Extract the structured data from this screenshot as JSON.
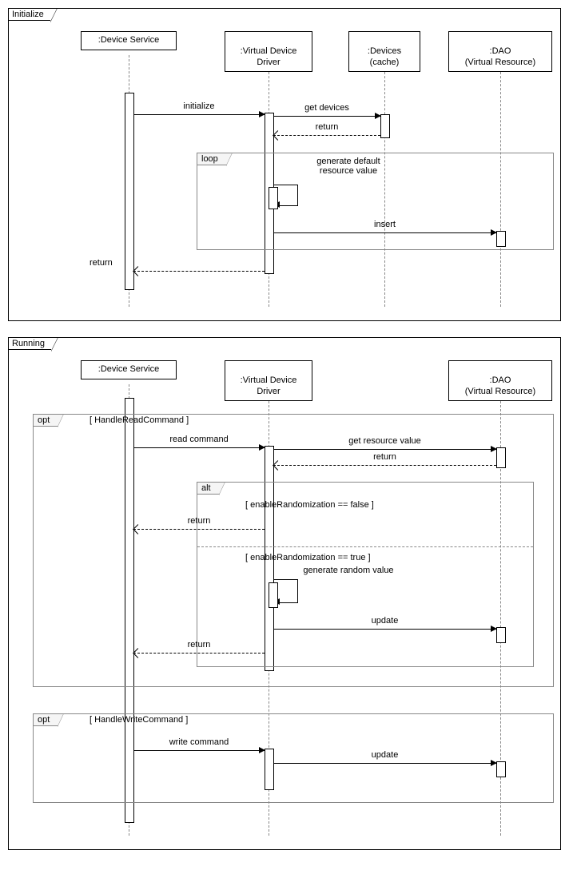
{
  "frame1": {
    "title": "Initialize",
    "participants": {
      "p1": ":Device Service",
      "p2": ":Virtual Device\nDriver",
      "p3": ":Devices\n(cache)",
      "p4": ":DAO\n(Virtual Resource)"
    },
    "messages": {
      "m1": "initialize",
      "m2": "get devices",
      "m3": "return",
      "m4": "generate default\nresource value",
      "m5": "insert",
      "m6": "return"
    },
    "fragments": {
      "loop": "loop"
    }
  },
  "frame2": {
    "title": "Running",
    "participants": {
      "p1": ":Device Service",
      "p2": ":Virtual Device\nDriver",
      "p3": ":DAO\n(Virtual Resource)"
    },
    "messages": {
      "m1": "read command",
      "m2": "get resource value",
      "m3": "return",
      "m4": "return",
      "m5": "generate random value",
      "m6": "update",
      "m7": "return",
      "m8": "write command",
      "m9": "update"
    },
    "fragments": {
      "opt1": "opt",
      "opt1_guard": "[ HandleReadCommand ]",
      "alt": "alt",
      "alt_guard1": "[ enableRandomization == false ]",
      "alt_guard2": "[ enableRandomization == true ]",
      "opt2": "opt",
      "opt2_guard": "[ HandleWriteCommand ]"
    }
  },
  "chart_data": [
    {
      "type": "sequence-diagram",
      "title": "Initialize",
      "participants": [
        ":Device Service",
        ":Virtual Device Driver",
        ":Devices (cache)",
        ":DAO (Virtual Resource)"
      ],
      "interactions": [
        {
          "from": ":Device Service",
          "to": ":Virtual Device Driver",
          "label": "initialize",
          "style": "sync"
        },
        {
          "from": ":Virtual Device Driver",
          "to": ":Devices (cache)",
          "label": "get devices",
          "style": "sync"
        },
        {
          "from": ":Devices (cache)",
          "to": ":Virtual Device Driver",
          "label": "return",
          "style": "return"
        },
        {
          "fragment": "loop",
          "contents": [
            {
              "from": ":Virtual Device Driver",
              "to": ":Virtual Device Driver",
              "label": "generate default resource value",
              "style": "self"
            },
            {
              "from": ":Virtual Device Driver",
              "to": ":DAO (Virtual Resource)",
              "label": "insert",
              "style": "sync"
            }
          ]
        },
        {
          "from": ":Virtual Device Driver",
          "to": ":Device Service",
          "label": "return",
          "style": "return"
        }
      ]
    },
    {
      "type": "sequence-diagram",
      "title": "Running",
      "participants": [
        ":Device Service",
        ":Virtual Device Driver",
        ":DAO (Virtual Resource)"
      ],
      "interactions": [
        {
          "fragment": "opt",
          "guard": "[ HandleReadCommand ]",
          "contents": [
            {
              "from": ":Device Service",
              "to": ":Virtual Device Driver",
              "label": "read command",
              "style": "sync"
            },
            {
              "from": ":Virtual Device Driver",
              "to": ":DAO (Virtual Resource)",
              "label": "get resource value",
              "style": "sync"
            },
            {
              "from": ":DAO (Virtual Resource)",
              "to": ":Virtual Device Driver",
              "label": "return",
              "style": "return"
            },
            {
              "fragment": "alt",
              "operands": [
                {
                  "guard": "[ enableRandomization == false ]",
                  "contents": [
                    {
                      "from": ":Virtual Device Driver",
                      "to": ":Device Service",
                      "label": "return",
                      "style": "return"
                    }
                  ]
                },
                {
                  "guard": "[ enableRandomization == true ]",
                  "contents": [
                    {
                      "from": ":Virtual Device Driver",
                      "to": ":Virtual Device Driver",
                      "label": "generate random value",
                      "style": "self"
                    },
                    {
                      "from": ":Virtual Device Driver",
                      "to": ":DAO (Virtual Resource)",
                      "label": "update",
                      "style": "sync"
                    },
                    {
                      "from": ":Virtual Device Driver",
                      "to": ":Device Service",
                      "label": "return",
                      "style": "return"
                    }
                  ]
                }
              ]
            }
          ]
        },
        {
          "fragment": "opt",
          "guard": "[ HandleWriteCommand ]",
          "contents": [
            {
              "from": ":Device Service",
              "to": ":Virtual Device Driver",
              "label": "write command",
              "style": "sync"
            },
            {
              "from": ":Virtual Device Driver",
              "to": ":DAO (Virtual Resource)",
              "label": "update",
              "style": "sync"
            }
          ]
        }
      ]
    }
  ]
}
